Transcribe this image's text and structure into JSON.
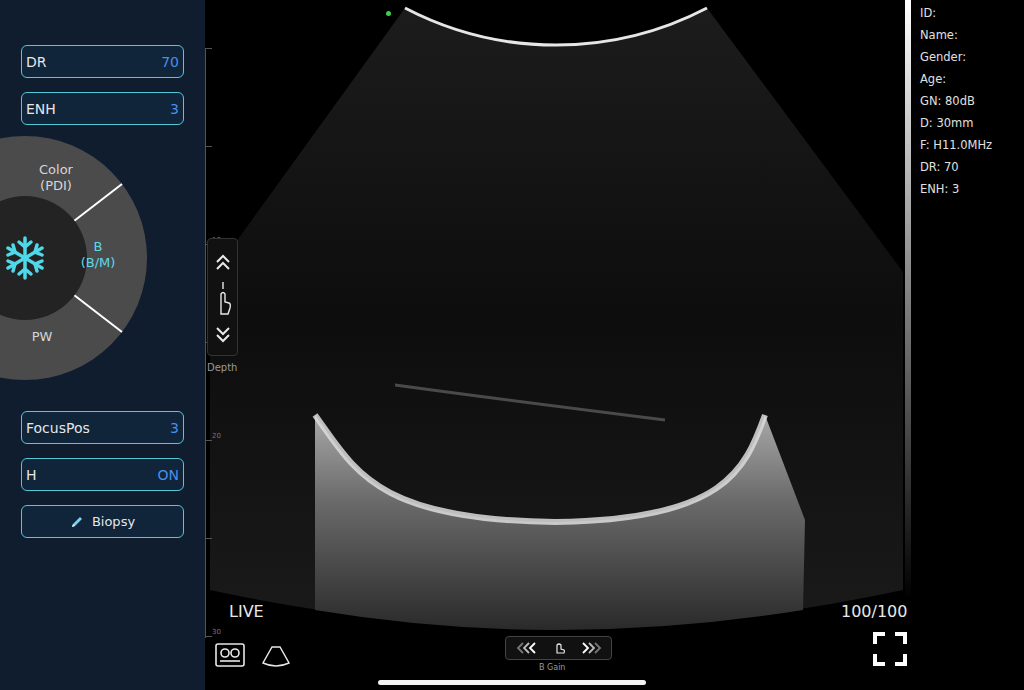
{
  "sidebar": {
    "top_buttons": [
      {
        "label": "DR",
        "value": "70"
      },
      {
        "label": "ENH",
        "value": "3"
      }
    ],
    "mode_wheel": {
      "modes": [
        {
          "label": "Color",
          "sublabel": "(PDI)",
          "selected": false
        },
        {
          "label": "B",
          "sublabel": "(B/M)",
          "selected": true
        },
        {
          "label": "PW",
          "sublabel": "",
          "selected": false
        }
      ]
    },
    "bottom_buttons": [
      {
        "label": "FocusPos",
        "value": "3",
        "kind": "value"
      },
      {
        "label": "H",
        "value": "ON",
        "kind": "value"
      },
      {
        "label": "Biopsy",
        "value": "",
        "kind": "action"
      }
    ]
  },
  "image": {
    "depth_ticks": [
      "10",
      "20",
      "30"
    ],
    "depth_label": "Depth",
    "status": "LIVE",
    "frame_counter": "100/100",
    "gain_label": "B Gain"
  },
  "info": [
    "ID:",
    "Name:",
    "Gender:",
    "Age:",
    "GN: 80dB",
    "D: 30mm",
    "F: H11.0MHz",
    "DR: 70",
    "ENH: 3"
  ]
}
